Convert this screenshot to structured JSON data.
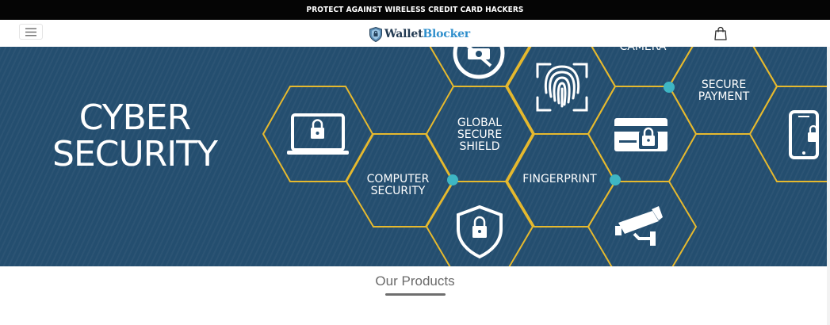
{
  "announcement": {
    "text": "PROTECT AGAINST WIRELESS CREDIT CARD HACKERS"
  },
  "header": {
    "logo_word1": "Wallet",
    "logo_word2": "Blocker",
    "menu_icon": "hamburger-icon",
    "cart_icon": "shopping-bag-icon"
  },
  "hero": {
    "title_line1": "CYBER",
    "title_line2": "SECURITY",
    "labels": {
      "camera": "CAMERA",
      "secure_payment_l1": "SECURE",
      "secure_payment_l2": "PAYMENT",
      "global_l1": "GLOBAL",
      "global_l2": "SECURE",
      "global_l3": "SHIELD",
      "computer_l1": "COMPUTER",
      "computer_l2": "SECURITY",
      "fingerprint": "FINGERPRINT"
    },
    "colors": {
      "background": "#244e6f",
      "hex_outline": "#e6b92e",
      "node": "#3eb6c4"
    }
  },
  "section": {
    "title": "Our Products"
  }
}
